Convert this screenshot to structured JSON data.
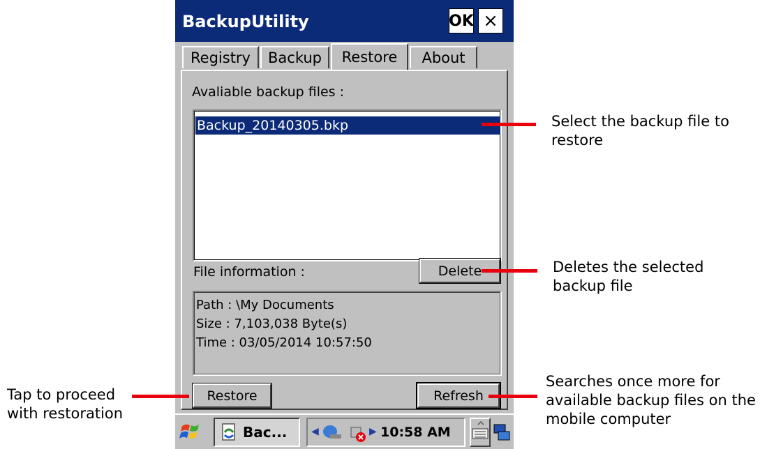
{
  "window": {
    "title": "BackupUtility",
    "ok_label": "OK",
    "close_label": "×"
  },
  "tabs": [
    {
      "label": "Registry",
      "active": false
    },
    {
      "label": "Backup",
      "active": false
    },
    {
      "label": "Restore",
      "active": true
    },
    {
      "label": "About",
      "active": false
    }
  ],
  "restore": {
    "files_label": "Avaliable backup files :",
    "files": [
      "Backup_20140305.bkp"
    ],
    "selected_file": "Backup_20140305.bkp",
    "info_label": "File information :",
    "delete_label": "Delete",
    "info_lines": [
      "Path : \\My Documents",
      "Size : 7,103,038 Byte(s)",
      "Time : 03/05/2014 10:57:50"
    ],
    "restore_label": "Restore",
    "refresh_label": "Refresh"
  },
  "taskbar": {
    "start_icon": "windows-flag-icon",
    "task_label": "Bac...",
    "clock": "10:58 AM",
    "tray_icons": [
      "network-icon",
      "disconnected-icon"
    ],
    "keyboard_icon": "keyboard-icon",
    "desktop_icon": "desktop-icon"
  },
  "annotations": {
    "select_file": "Select the backup file to restore",
    "delete": "Deletes the selected backup file",
    "restore": "Tap to proceed with restoration",
    "refresh": "Searches once more for available backup files on the mobile computer"
  },
  "colors": {
    "titlebar": "#0b2a78",
    "selection": "#0b2a78",
    "callout": "#e8000c",
    "surface": "#c0c0c0"
  }
}
